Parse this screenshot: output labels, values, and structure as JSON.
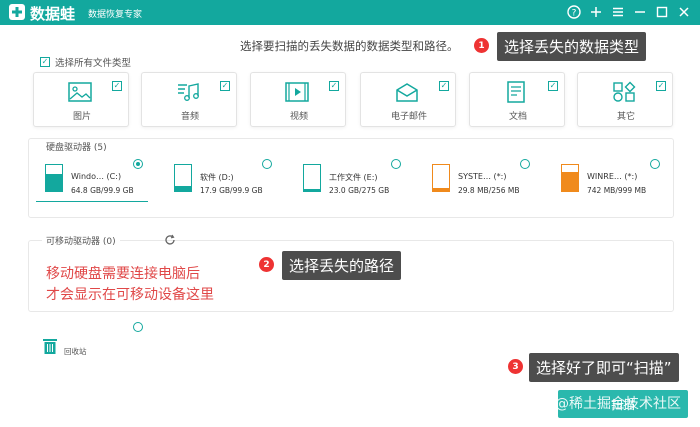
{
  "app": {
    "name": "数据蛙",
    "subtitle": "数据恢复专家",
    "icon": "frog-logo-icon"
  },
  "window_controls": [
    "help-icon",
    "plus-icon",
    "menu-icon",
    "minimize-icon",
    "maximize-icon",
    "close-icon"
  ],
  "instruction": "选择要扫描的丢失数据的数据类型和路径。",
  "select_all": {
    "label": "选择所有文件类型",
    "checked": true
  },
  "file_types": [
    {
      "label": "图片",
      "icon": "image-icon",
      "checked": true
    },
    {
      "label": "音频",
      "icon": "music-icon",
      "checked": true
    },
    {
      "label": "视频",
      "icon": "video-icon",
      "checked": true
    },
    {
      "label": "电子邮件",
      "icon": "mail-icon",
      "checked": true
    },
    {
      "label": "文档",
      "icon": "document-icon",
      "checked": true
    },
    {
      "label": "其它",
      "icon": "other-icon",
      "checked": true
    }
  ],
  "hard_drives": {
    "title": "硬盘驱动器 (5)",
    "items": [
      {
        "name": "Windo… (C:)",
        "size": "64.8 GB/99.9 GB",
        "selected": true,
        "fill": 0.65,
        "color": "#13a89e"
      },
      {
        "name": "软件 (D:)",
        "size": "17.9 GB/99.9 GB",
        "selected": false,
        "fill": 0.18,
        "color": "#13a89e"
      },
      {
        "name": "工作文件 (E:)",
        "size": "23.0 GB/275 GB",
        "selected": false,
        "fill": 0.08,
        "color": "#13a89e"
      },
      {
        "name": "SYSTE… (*:)",
        "size": "29.8 MB/256 MB",
        "selected": false,
        "fill": 0.12,
        "color": "#f08a1c"
      },
      {
        "name": "WINRE… (*:)",
        "size": "742 MB/999 MB",
        "selected": false,
        "fill": 0.74,
        "color": "#f08a1c"
      }
    ]
  },
  "removable": {
    "title": "可移动驱动器 (0)",
    "refresh_icon": "refresh-icon",
    "note_line1": "移动硬盘需要连接电脑后",
    "note_line2": "才会显示在可移动设备这里"
  },
  "recycle_bin": {
    "label": "回收站",
    "icon": "trash-icon",
    "selected": false
  },
  "annotations": [
    {
      "num": "1",
      "text": "选择丢失的数据类型"
    },
    {
      "num": "2",
      "text": "选择丢失的路径"
    },
    {
      "num": "3",
      "text": "选择好了即可“扫描”"
    }
  ],
  "scan_button": {
    "label": "扫描"
  },
  "watermark": "@稀土掘金技术社区",
  "colors": {
    "accent": "#13a89e",
    "orange": "#f08a1c",
    "annotation_red": "#e33333",
    "note_red": "#e04848"
  }
}
